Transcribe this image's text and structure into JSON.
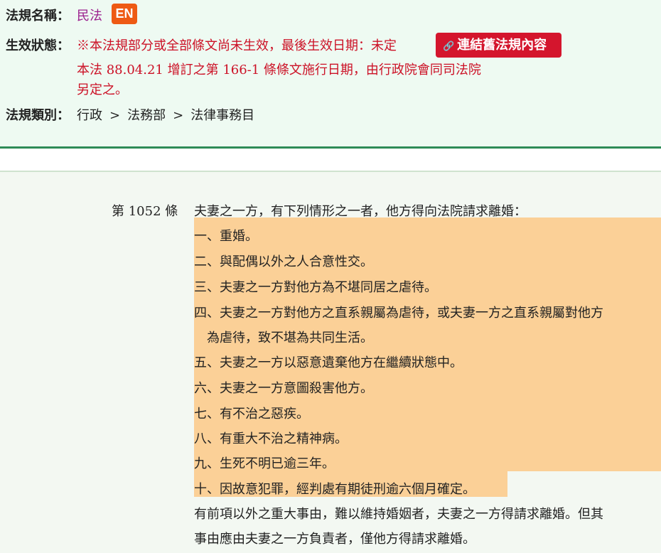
{
  "header": {
    "law_name_label": "法規名稱：",
    "law_name": "民法",
    "en_badge": "EN",
    "status_label": "生效狀態：",
    "status_line1": "※本法規部分或全部條文尚未生效，最後生效日期：未定",
    "status_line2": "本法 88.04.21 增訂之第 166-1  條條文施行日期，由行政院會同司法院",
    "status_line3": "另定之。",
    "old_link_button": "連結舊法規內容",
    "old_link_icon": "link-icon",
    "category_label": "法規類別：",
    "category_path": [
      "行政",
      "法務部",
      "法律事務目"
    ],
    "category_sep": ">"
  },
  "article": {
    "number": "第 1052 條",
    "intro": "夫妻之一方，有下列情形之一者，他方得向法院請求離婚：",
    "items": [
      "一、重婚。",
      "二、與配偶以外之人合意性交。",
      "三、夫妻之一方對他方為不堪同居之虐待。",
      "四、夫妻之一方對他方之直系親屬為虐待，或夫妻一方之直系親屬對他方",
      "　為虐待，致不堪為共同生活。",
      "五、夫妻之一方以惡意遺棄他方在繼續狀態中。",
      "六、夫妻之一方意圖殺害他方。",
      "七、有不治之惡疾。",
      "八、有重大不治之精神病。",
      "九、生死不明已逾三年。",
      "十、因故意犯罪，經判處有期徒刑逾六個月確定。"
    ],
    "closing_line1": "有前項以外之重大事由，難以維持婚姻者，夫妻之一方得請求離婚。但其",
    "closing_line2": "事由應由夫妻之一方負責者，僅他方得請求離婚。",
    "highlight_color": "#fbd097"
  }
}
